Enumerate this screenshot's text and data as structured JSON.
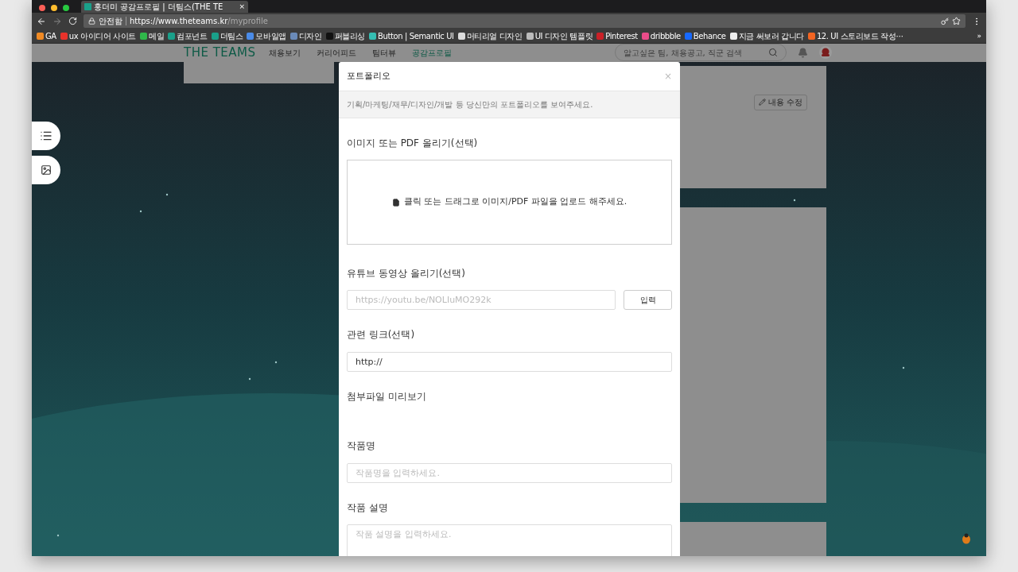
{
  "browser": {
    "tab": {
      "title": "홍더미 공감프로필 | 더팀스(THE TE",
      "close": "×"
    },
    "address": {
      "secure_label": "안전함",
      "host": "https://www.theteams.kr",
      "path": "/myprofile"
    },
    "bookmarks": [
      {
        "label": "GA",
        "color": "#f08a24"
      },
      {
        "label": "ux 아이디어 사이트",
        "color": "#e8322b"
      },
      {
        "label": "메일",
        "color": "#2fb84a"
      },
      {
        "label": "컴포넌트",
        "color": "#1aa08a"
      },
      {
        "label": "더팀스",
        "color": "#1aa08a"
      },
      {
        "label": "모바일앱",
        "color": "#4a8be8"
      },
      {
        "label": "디자인",
        "color": "#6a8ab8"
      },
      {
        "label": "퍼블리싱",
        "color": "#111111"
      },
      {
        "label": "Button | Semantic UI",
        "color": "#35bdb2"
      },
      {
        "label": "머티리얼 디자인",
        "color": "#dddddd"
      },
      {
        "label": "UI 디자인 템플릿",
        "color": "#bbbbbb"
      },
      {
        "label": "Pinterest",
        "color": "#cb2027"
      },
      {
        "label": "dribbble",
        "color": "#ea4c89"
      },
      {
        "label": "Behance",
        "color": "#1769ff"
      },
      {
        "label": "지금 써보러 갑니다",
        "color": "#eeeeee"
      },
      {
        "label": "12. UI 스토리보드 작성⋯",
        "color": "#f26522"
      }
    ],
    "more": "»"
  },
  "site": {
    "logo": "THE TEAMS",
    "nav": [
      {
        "label": "채용보기",
        "selected": false
      },
      {
        "label": "커리어피드",
        "selected": false
      },
      {
        "label": "팀터뷰",
        "selected": false
      },
      {
        "label": "공감프로필",
        "selected": true
      }
    ],
    "search": {
      "placeholder": "알고싶은 팀, 채용공고, 직군 검색"
    },
    "edit_button": "내용 수정"
  },
  "modal": {
    "title": "포트폴리오",
    "close": "×",
    "intro": "기획/마케팅/재무/디자인/개발 등 당신만의 포트폴리오를 보여주세요.",
    "sections": [
      {
        "kind": "upload",
        "label": "이미지 또는 PDF 올리기(선택)",
        "hint": "클릭 또는 드래그로 이미지/PDF 파일을 업로드 해주세요."
      },
      {
        "kind": "url",
        "label": "유튜브 동영상 올리기(선택)",
        "placeholder": "https://youtu.be/NOLIuMO292k",
        "button": "입력"
      },
      {
        "kind": "input",
        "label": "관련 링크(선택)",
        "value": "http://"
      },
      {
        "kind": "heading",
        "label": "첨부파일 미리보기"
      },
      {
        "kind": "input",
        "label": "작품명",
        "placeholder": "작품명을 입력하세요."
      },
      {
        "kind": "textarea",
        "label": "작품 설명",
        "placeholder": "작품 설명을 입력하세요."
      }
    ]
  }
}
